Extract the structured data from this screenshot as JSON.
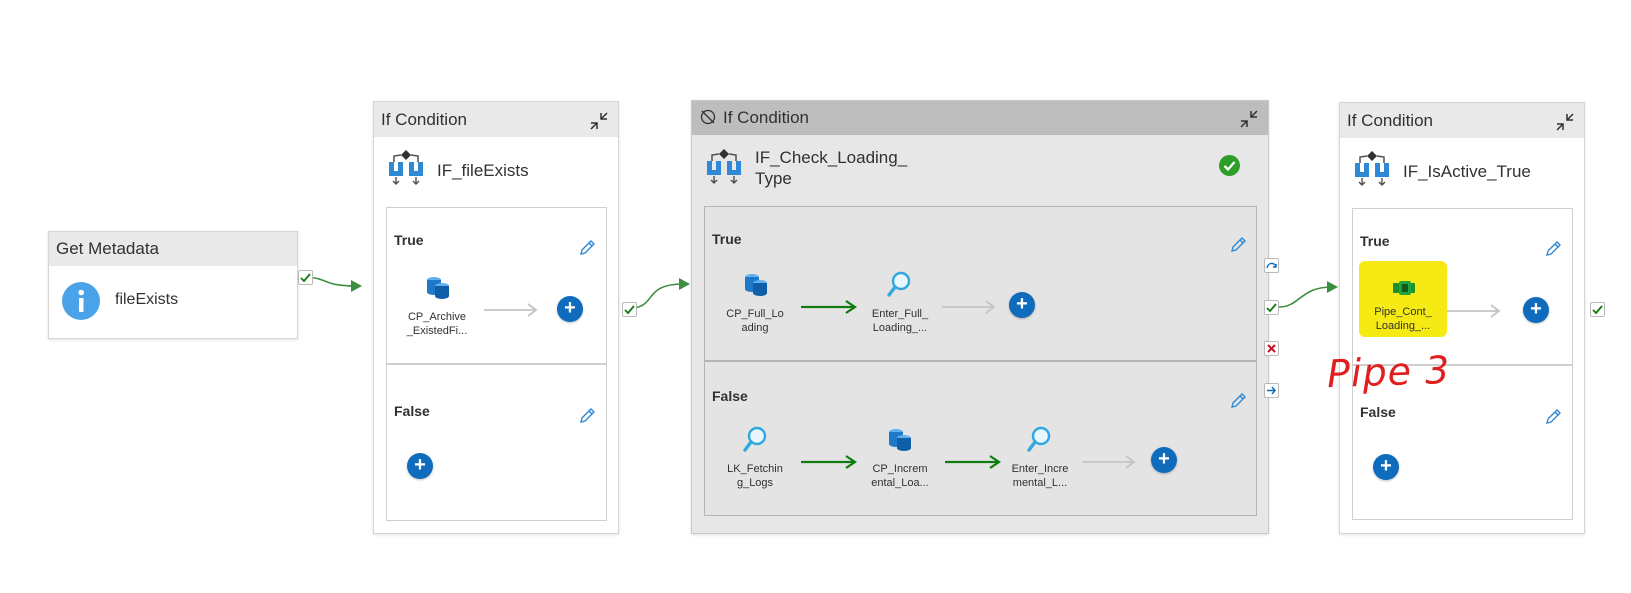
{
  "get_metadata": {
    "header": "Get Metadata",
    "name": "fileExists"
  },
  "if1": {
    "header": "If Condition",
    "name": "IF_fileExists",
    "true_label": "True",
    "false_label": "False",
    "true_activity": {
      "line1": "CP_Archive",
      "line2": "_ExistedFi..."
    }
  },
  "if2": {
    "header": "If Condition",
    "name_line1": "IF_Check_Loading_",
    "name_line2": "Type",
    "true_label": "True",
    "false_label": "False",
    "true_activities": [
      {
        "line1": "CP_Full_Lo",
        "line2": "ading"
      },
      {
        "line1": "Enter_Full_",
        "line2": "Loading_..."
      }
    ],
    "false_activities": [
      {
        "line1": "LK_Fetchin",
        "line2": "g_Logs"
      },
      {
        "line1": "CP_Increm",
        "line2": "ental_Loa..."
      },
      {
        "line1": "Enter_Incre",
        "line2": "mental_L..."
      }
    ]
  },
  "if3": {
    "header": "If Condition",
    "name": "IF_IsActive_True",
    "true_label": "True",
    "false_label": "False",
    "true_activity": {
      "line1": "Pipe_Cont_",
      "line2": "Loading_..."
    }
  },
  "annotation": {
    "text": "Pipe 3",
    "color": "#e02020"
  },
  "colors": {
    "accent": "#0f6cbd",
    "success": "#107c10",
    "highlight": "#f5ea14",
    "error": "#c50f1f"
  }
}
